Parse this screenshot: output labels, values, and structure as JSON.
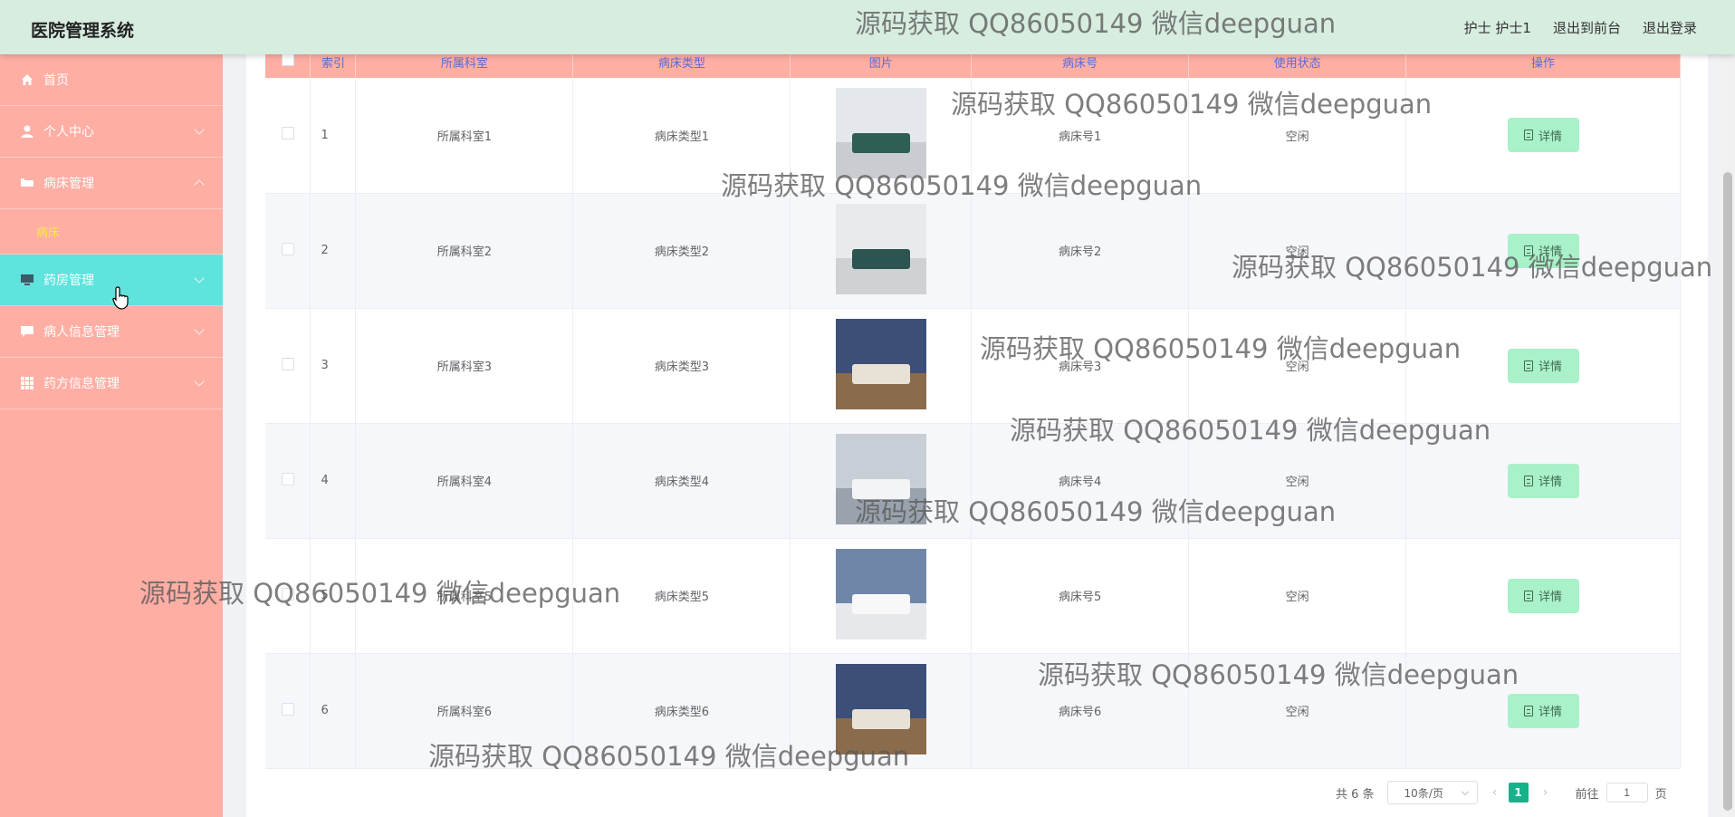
{
  "app": {
    "title": "医院管理系统"
  },
  "header": {
    "user": "护士 护士1",
    "to_front": "退出到前台",
    "logout": "退出登录"
  },
  "sidebar": {
    "items": [
      {
        "label": "首页",
        "icon": "home-icon"
      },
      {
        "label": "个人中心",
        "icon": "user-icon"
      },
      {
        "label": "病床管理",
        "icon": "bed-icon"
      },
      {
        "label": "病床"
      },
      {
        "label": "药房管理",
        "icon": "monitor-icon"
      },
      {
        "label": "病人信息管理",
        "icon": "chat-icon"
      },
      {
        "label": "药方信息管理",
        "icon": "grid-icon"
      }
    ]
  },
  "table": {
    "headers": [
      "索引",
      "所属科室",
      "病床类型",
      "图片",
      "病床号",
      "使用状态",
      "操作"
    ],
    "rows": [
      {
        "index": "1",
        "dept": "所属科室1",
        "type": "病床类型1",
        "bed_no": "病床号1",
        "status": "空闲",
        "action": "详情"
      },
      {
        "index": "2",
        "dept": "所属科室2",
        "type": "病床类型2",
        "bed_no": "病床号2",
        "status": "空闲",
        "action": "详情"
      },
      {
        "index": "3",
        "dept": "所属科室3",
        "type": "病床类型3",
        "bed_no": "病床号3",
        "status": "空闲",
        "action": "详情"
      },
      {
        "index": "4",
        "dept": "所属科室4",
        "type": "病床类型4",
        "bed_no": "病床号4",
        "status": "空闲",
        "action": "详情"
      },
      {
        "index": "5",
        "dept": "所属科室5",
        "type": "病床类型5",
        "bed_no": "病床号5",
        "status": "空闲",
        "action": "详情"
      },
      {
        "index": "6",
        "dept": "所属科室6",
        "type": "病床类型6",
        "bed_no": "病床号6",
        "status": "空闲",
        "action": "详情"
      }
    ]
  },
  "pagination": {
    "total": "共 6 条",
    "page_size": "10条/页",
    "current_page": "1",
    "goto_label": "前往",
    "goto_value": "1",
    "page_unit": "页"
  },
  "watermark": {
    "text": "源码获取 QQ86050149 微信deepguan"
  },
  "colors": {
    "header_bg": "#d7ede0",
    "sidebar_bg": "#ffaea4",
    "active_menu": "#5fe3dd",
    "submenu_text": "#f5e94a",
    "table_header": "#ffaea4",
    "detail_button": "#a9f1c8",
    "pager_active": "#16b38a"
  }
}
